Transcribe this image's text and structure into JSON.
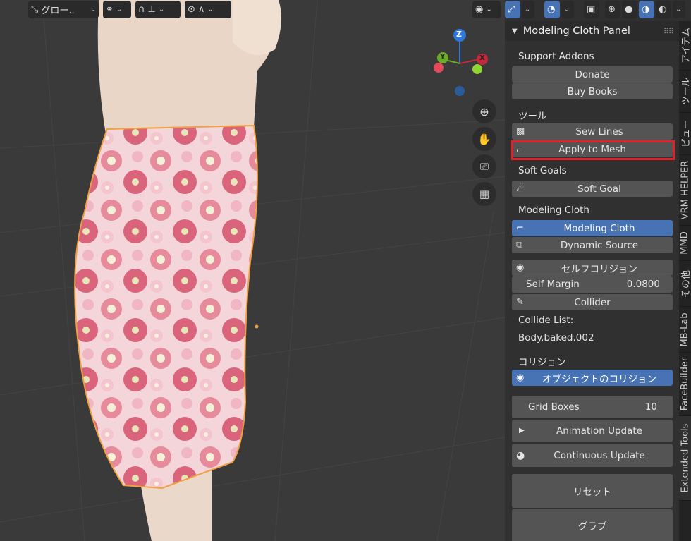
{
  "header_toolbar": {
    "transform_orientation": "グロー..",
    "icons": [
      "transform-orientation-icon",
      "pivot-icon",
      "snap-icon",
      "snap-increment-icon",
      "proportional-edit-icon",
      "falloff-icon"
    ]
  },
  "viewport_overlay_icons": [
    "visibility-icon",
    "gizmo-icon",
    "overlay-icon",
    "xray-icon",
    "wireframe-shading-icon",
    "solid-shading-icon",
    "material-shading-icon",
    "rendered-shading-icon"
  ],
  "gizmo": {
    "z": "Z",
    "y": "Y",
    "x": "X"
  },
  "nav_buttons": [
    "zoom-icon",
    "pan-hand-icon",
    "camera-icon",
    "ortho-grid-icon"
  ],
  "panel": {
    "title": "Modeling Cloth Panel",
    "support_addons": {
      "label": "Support Addons",
      "donate": "Donate",
      "buy_books": "Buy Books"
    },
    "tools": {
      "label": "ツール",
      "sew_lines": "Sew Lines",
      "apply_to_mesh": "Apply to Mesh"
    },
    "soft_goals": {
      "label": "Soft Goals",
      "soft_goal": "Soft Goal"
    },
    "modeling_cloth": {
      "label": "Modeling Cloth",
      "modeling_cloth_btn": "Modeling Cloth",
      "dynamic_source": "Dynamic Source",
      "self_collision": "セルフコリジョン",
      "self_margin_label": "Self Margin",
      "self_margin_value": "0.0800",
      "collider": "Collider",
      "collide_list_label": "Collide List:",
      "collide_list_item": "Body.baked.002"
    },
    "collision": {
      "label": "コリジョン",
      "object_collision": "オブジェクトのコリジョン"
    },
    "grid_boxes_label": "Grid Boxes",
    "grid_boxes_value": "10",
    "animation_update": "Animation Update",
    "continuous_update": "Continuous Update",
    "reset": "リセット",
    "grab": "グラブ"
  },
  "side_tabs": [
    "アイテム",
    "ツール",
    "ビュー",
    "VRM HELPER",
    "MMD",
    "その他",
    "MB-Lab",
    "FaceBuilder",
    "Extended Tools"
  ],
  "colors": {
    "active_blue": "#4772b3",
    "highlight_red": "#e3212b",
    "skirt_pink": "#e89aa8",
    "selection_orange": "#f0a040"
  }
}
